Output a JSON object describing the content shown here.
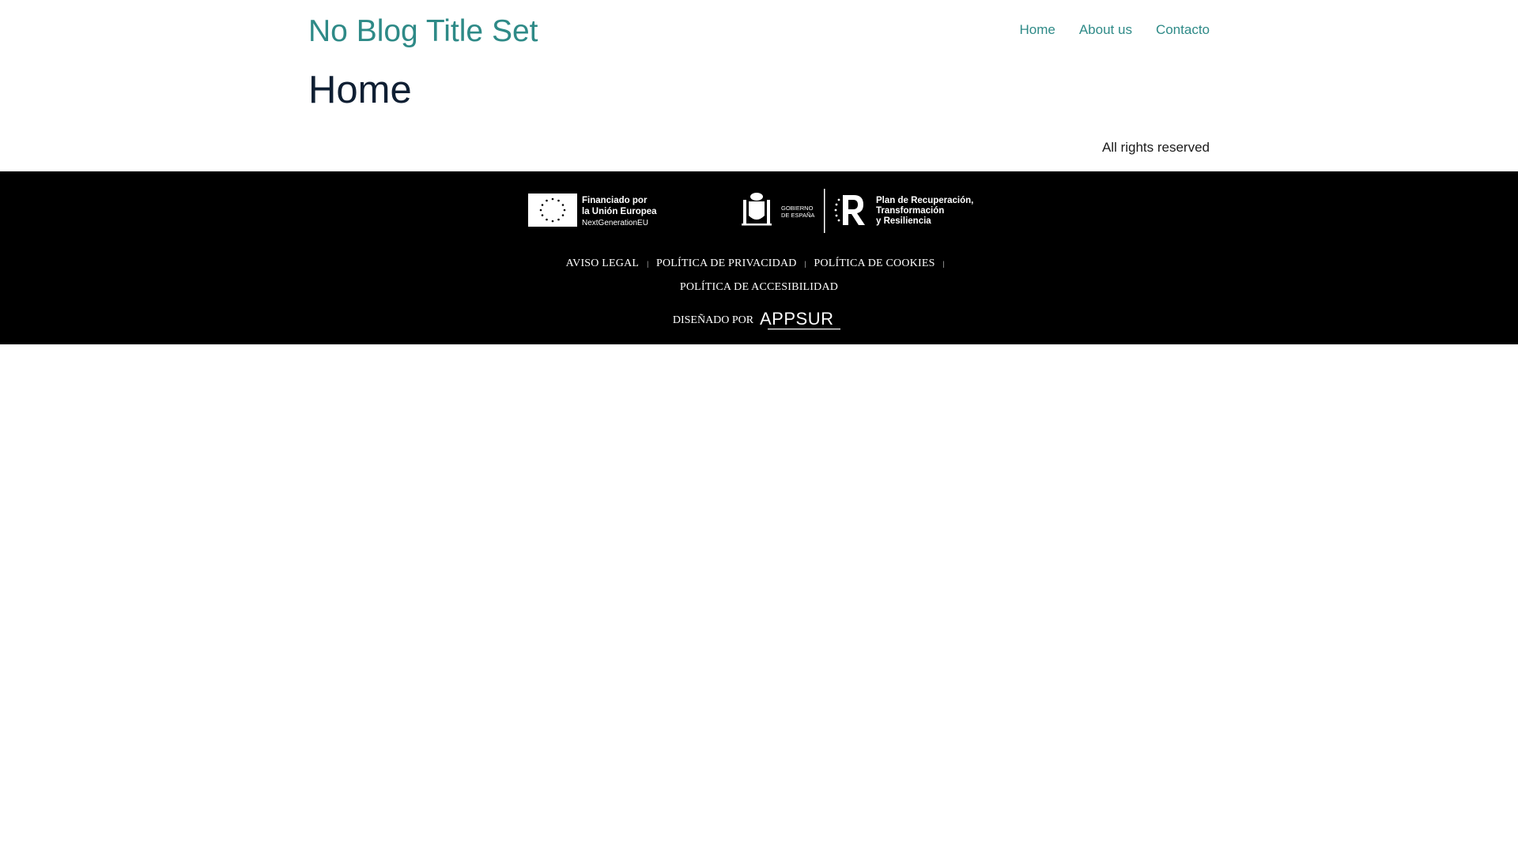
{
  "header": {
    "blog_title": "No Blog Title Set",
    "nav": [
      {
        "label": "Home"
      },
      {
        "label": "About us"
      },
      {
        "label": "Contacto"
      }
    ]
  },
  "main": {
    "page_title": "Home",
    "rights": "All rights reserved"
  },
  "footer": {
    "eu_logo": {
      "line1": "Financiado por",
      "line2": "la Unión Europea",
      "line3": "NextGenerationEU"
    },
    "gov_logo": {
      "gob_line1": "GOBIERNO",
      "gob_line2": "DE ESPAÑA",
      "plan_line1": "Plan de Recuperación,",
      "plan_line2": "Transformación",
      "plan_line3": "y Resiliencia"
    },
    "legal_links": [
      {
        "label": "AVISO LEGAL"
      },
      {
        "label": "POLÍTICA DE PRIVACIDAD"
      },
      {
        "label": "POLÍTICA DE COOKIES"
      },
      {
        "label": "POLÍTICA DE ACCESIBILIDAD"
      }
    ],
    "separator": "|",
    "credit_label": "DISEÑADO POR",
    "credit_brand": "APPSUR"
  },
  "colors": {
    "accent": "#2e8a87",
    "footer_bg": "#000000"
  }
}
